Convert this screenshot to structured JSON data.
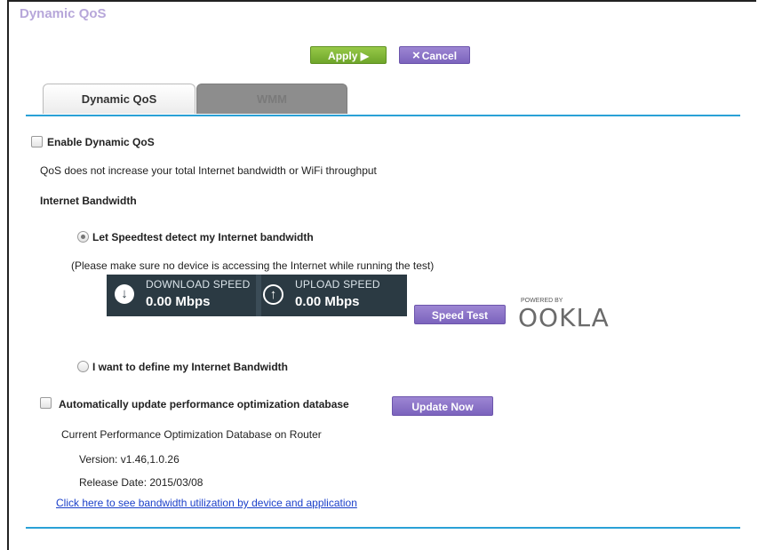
{
  "page": {
    "title": "Dynamic QoS"
  },
  "actions": {
    "apply_label": "Apply ▶",
    "cancel_label": "Cancel",
    "cancel_icon": "×"
  },
  "tabs": [
    {
      "label": "Dynamic QoS",
      "active": true
    },
    {
      "label": "WMM",
      "active": false
    }
  ],
  "qos": {
    "enable_label": "Enable Dynamic QoS",
    "note": "QoS does not increase your total Internet bandwidth or WiFi throughput",
    "bandwidth_heading": "Internet Bandwidth",
    "option_speedtest": "Let Speedtest detect my Internet bandwidth",
    "option_speedtest_selected": true,
    "speedtest_note": "(Please make sure no device is accessing the Internet while running the test)",
    "option_define": "I want to define my Internet Bandwidth"
  },
  "speed_panel": {
    "download_label": "DOWNLOAD SPEED",
    "download_value": "0.00 Mbps",
    "download_icon": "download-arrow-icon",
    "upload_label": "UPLOAD SPEED",
    "upload_value": "0.00 Mbps",
    "upload_icon": "upload-arrow-icon",
    "speed_test_label": "Speed Test",
    "powered_by": "POWERED BY",
    "brand": "OOKLA"
  },
  "database": {
    "auto_update_label": "Automatically update performance optimization database",
    "update_now_label": "Update Now",
    "current_label": "Current Performance Optimization Database on Router",
    "version": "Version: v1.46,1.0.26",
    "release_date": "Release Date: 2015/03/08"
  },
  "link_text": "Click here to see bandwidth utilization by device and application",
  "colors": {
    "accent_line": "#2aa1d6",
    "apply_green": "#7fb535",
    "button_purple": "#8a73c8",
    "title_lavender": "#b7a7da",
    "speed_panel_bg": "#2b3a43",
    "link_blue": "#1a3fc9"
  }
}
